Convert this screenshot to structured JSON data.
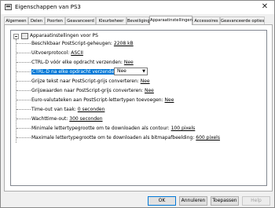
{
  "window": {
    "title": "Eigenschappen van            PS3",
    "close_label": "✕"
  },
  "tabs": [
    {
      "label": "Algemeen"
    },
    {
      "label": "Delen"
    },
    {
      "label": "Poorten"
    },
    {
      "label": "Geavanceerd"
    },
    {
      "label": "Kleurbeheer"
    },
    {
      "label": "Beveiliging"
    },
    {
      "label": "Apparaatinstellingen",
      "active": true
    },
    {
      "label": "Accessoires"
    },
    {
      "label": "Geavanceerde opties"
    }
  ],
  "tree": {
    "root_label": "Apparaatinstellingen voor            PS",
    "items": [
      {
        "label": "Beschikbaar PostScript-geheugen:",
        "value": "2208 kB"
      },
      {
        "label": "Uitvoerprotocol:",
        "value": "ASCII"
      },
      {
        "label": "CTRL-D vóór elke opdracht verzenden:",
        "value": "Nee"
      },
      {
        "label": "CTRL-D na elke opdracht verzenden:",
        "value": "Nee",
        "selected": true
      },
      {
        "label": "Grijze tekst naar PostScript-grijs converteren:",
        "value": "Nee"
      },
      {
        "label": "Grijswaarden naar PostScript-grijs converteren:",
        "value": "Nee"
      },
      {
        "label": "Euro-valutateken aan PostScript-lettertypen toevoegen:",
        "value": "Nee"
      },
      {
        "label": "Time-out van taak:",
        "value": "0 seconden"
      },
      {
        "label": "Wachttime-out:",
        "value": "300 seconden"
      },
      {
        "label": "Minimale lettertypegrootte om te downloaden als contour:",
        "value": "100 pixels"
      },
      {
        "label": "Maximale lettertypegrootte om te downloaden als bitmapafbeelding:",
        "value": "600 pixels"
      }
    ]
  },
  "buttons": {
    "ok": "OK",
    "cancel": "Annuleren",
    "apply": "Toepassen",
    "help": "Help"
  },
  "colors": {
    "selection": "#0078d7",
    "link_text": "#000000"
  }
}
